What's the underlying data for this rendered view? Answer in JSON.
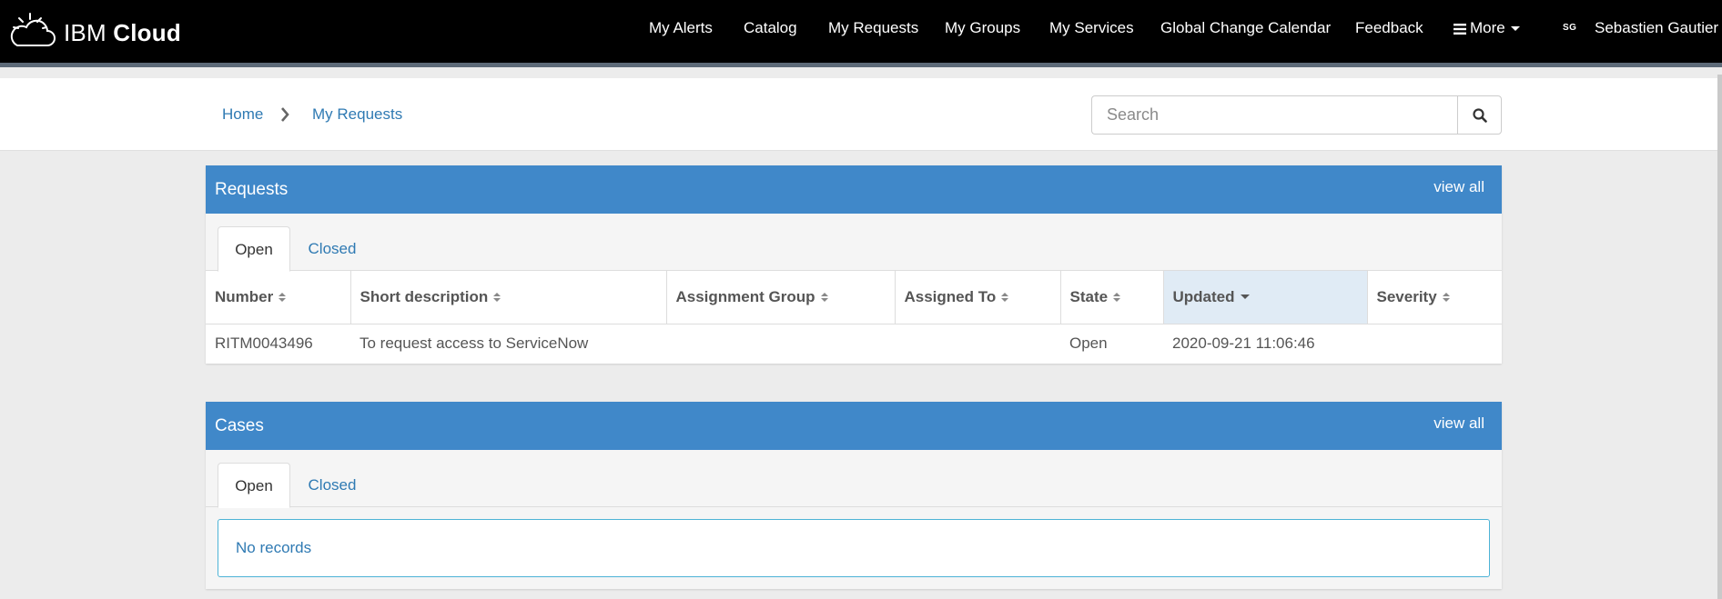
{
  "brand": {
    "prefix": "IBM",
    "name": "Cloud"
  },
  "nav": {
    "items": [
      "My Alerts",
      "Catalog",
      "My Requests",
      "My Groups",
      "My Services",
      "Global Change Calendar",
      "Feedback"
    ],
    "more_label": "More",
    "user_initials": "SG",
    "user_name": "Sebastien Gautier"
  },
  "breadcrumb": {
    "home": "Home",
    "current": "My Requests"
  },
  "search": {
    "placeholder": "Search",
    "value": ""
  },
  "requests": {
    "title": "Requests",
    "view_all": "view all",
    "tabs": [
      "Open",
      "Closed"
    ],
    "active_tab": "Open",
    "columns": [
      "Number",
      "Short description",
      "Assignment Group",
      "Assigned To",
      "State",
      "Updated",
      "Severity"
    ],
    "sorted_column": "Updated",
    "sort_direction": "descending",
    "rows": [
      {
        "number": "RITM0043496",
        "short_description": "To request access to ServiceNow",
        "assignment_group": "",
        "assigned_to": "",
        "state": "Open",
        "updated": "2020-09-21 11:06:46",
        "severity": ""
      }
    ]
  },
  "cases": {
    "title": "Cases",
    "view_all": "view all",
    "tabs": [
      "Open",
      "Closed"
    ],
    "active_tab": "Open",
    "empty_message": "No records"
  },
  "colors": {
    "panel_header": "#4088c9",
    "link": "#2f7ab3",
    "topbar": "#000000",
    "sorted_header_bg": "#e0ebf5"
  }
}
